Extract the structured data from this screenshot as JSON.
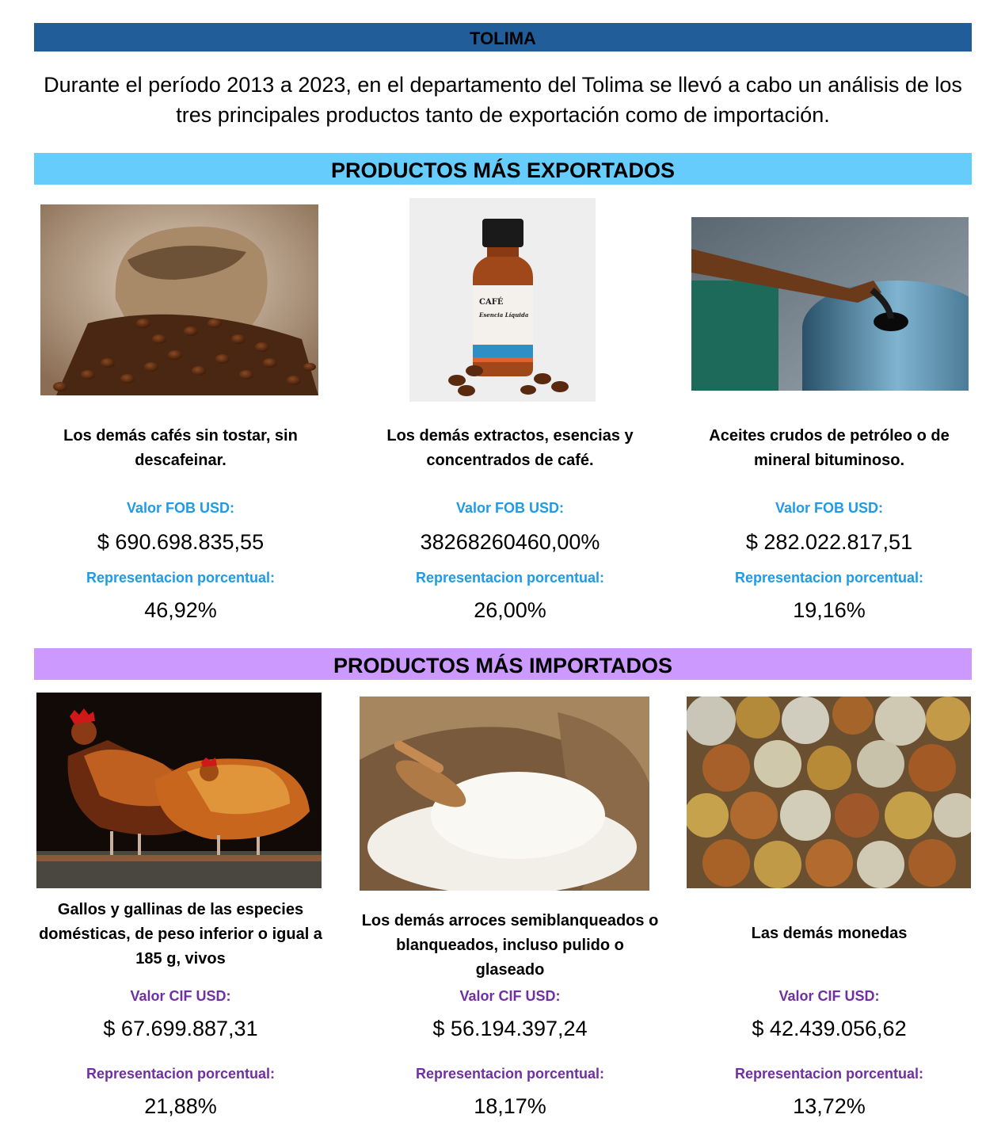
{
  "header": {
    "title": "TOLIMA"
  },
  "intro": "Durante el período 2013 a 2023, en el departamento del Tolima se llevó a cabo un análisis de los tres principales productos tanto de exportación como de importación.",
  "exports": {
    "title": "PRODUCTOS MÁS EXPORTADOS",
    "items": [
      {
        "name": "Los demás cafés sin tostar, sin descafeinar.",
        "value_label": "Valor FOB USD:",
        "value": "$ 690.698.835,55",
        "pct_label": "Representacion porcentual:",
        "pct": "46,92%",
        "image": "coffee-sack-image"
      },
      {
        "name": "Los demás extractos, esencias y concentrados de café.",
        "value_label": "Valor FOB USD:",
        "value": "38268260460,00%",
        "pct_label": "Representacion porcentual:",
        "pct": "26,00%",
        "image": "coffee-essence-bottle-image",
        "bottle_text": "CAFÉ",
        "bottle_sub": "Esencia Líquida"
      },
      {
        "name": "Aceites crudos de petróleo o de mineral bituminoso.",
        "value_label": "Valor FOB USD:",
        "value": "$ 282.022.817,51",
        "pct_label": "Representacion porcentual:",
        "pct": "19,16%",
        "image": "oil-barrel-image"
      }
    ]
  },
  "imports": {
    "title": "PRODUCTOS MÁS IMPORTADOS",
    "items": [
      {
        "name": "Gallos y gallinas de las especies domésticas, de peso inferior o igual a 185 g, vivos",
        "value_label": "Valor CIF USD:",
        "value": "$ 67.699.887,31",
        "pct_label": "Representacion porcentual:",
        "pct": "21,88%",
        "image": "chickens-image"
      },
      {
        "name": "Los demás arroces semiblanqueados o blanqueados, incluso pulido o glaseado",
        "value_label": "Valor CIF USD:",
        "value": "$ 56.194.397,24",
        "pct_label": "Representacion porcentual:",
        "pct": "18,17%",
        "image": "rice-sack-image"
      },
      {
        "name": "Las demás monedas",
        "value_label": "Valor CIF USD:",
        "value": "$ 42.439.056,62",
        "pct_label": "Representacion porcentual:",
        "pct": "13,72%",
        "image": "coins-image"
      }
    ]
  }
}
